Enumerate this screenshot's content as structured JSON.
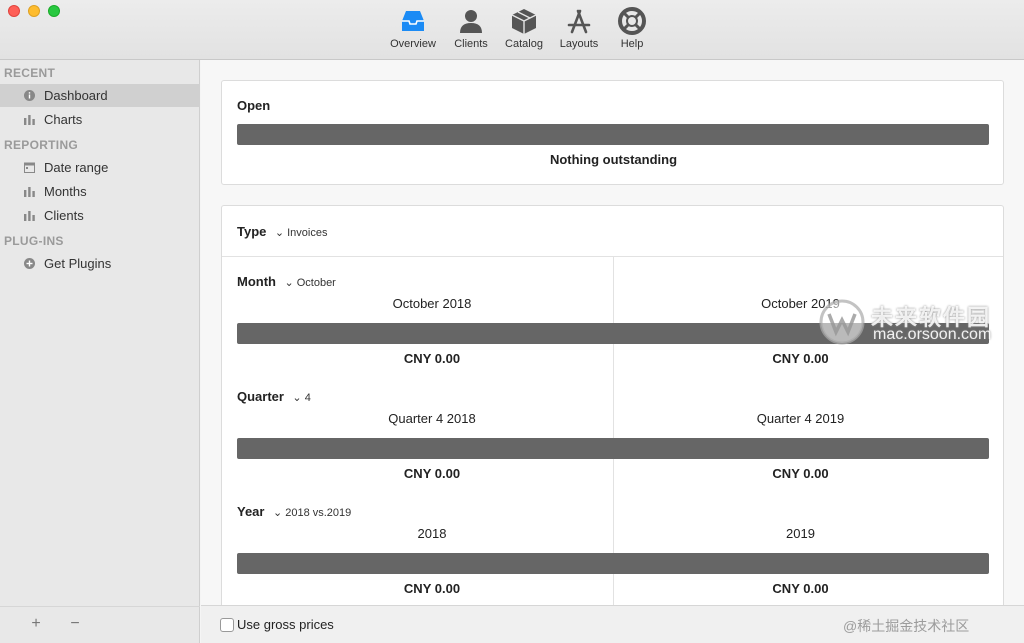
{
  "toolbar": {
    "items": [
      {
        "label": "Overview",
        "icon": "inbox-icon"
      },
      {
        "label": "Clients",
        "icon": "person-icon"
      },
      {
        "label": "Catalog",
        "icon": "box-icon"
      },
      {
        "label": "Layouts",
        "icon": "app-store-icon"
      },
      {
        "label": "Help",
        "icon": "lifebuoy-icon"
      }
    ],
    "accent": "#1b8bf5"
  },
  "sidebar": {
    "sections": [
      {
        "title": "RECENT",
        "items": [
          {
            "label": "Dashboard",
            "icon": "info-icon",
            "selected": true
          },
          {
            "label": "Charts",
            "icon": "bar-chart-icon"
          }
        ]
      },
      {
        "title": "REPORTING",
        "items": [
          {
            "label": "Date range",
            "icon": "calendar-icon"
          },
          {
            "label": "Months",
            "icon": "bar-chart-icon"
          },
          {
            "label": "Clients",
            "icon": "bar-chart-icon"
          }
        ]
      },
      {
        "title": "PLUG-INS",
        "items": [
          {
            "label": "Get Plugins",
            "icon": "plus-circle-icon"
          }
        ]
      }
    ],
    "footer": {
      "add": "+",
      "remove": "−"
    }
  },
  "open_card": {
    "title": "Open",
    "status": "Nothing outstanding"
  },
  "type_card": {
    "type_label": "Type",
    "type_value": "Invoices",
    "groups": [
      {
        "label": "Month",
        "selector": "October",
        "left": {
          "title": "October 2018",
          "amount": "CNY 0.00"
        },
        "right": {
          "title": "October 2019",
          "amount": "CNY 0.00"
        }
      },
      {
        "label": "Quarter",
        "selector": "4",
        "left": {
          "title": "Quarter 4 2018",
          "amount": "CNY 0.00"
        },
        "right": {
          "title": "Quarter 4 2019",
          "amount": "CNY 0.00"
        }
      },
      {
        "label": "Year",
        "selector": "2018 vs.2019",
        "left": {
          "title": "2018",
          "amount": "CNY 0.00"
        },
        "right": {
          "title": "2019",
          "amount": "CNY 0.00"
        }
      }
    ]
  },
  "bottom": {
    "gross_label": "Use gross prices",
    "gross_checked": false
  },
  "watermark": {
    "logo": "未来软件园",
    "url": "mac.orsoon.com",
    "corner": "@稀土掘金技术社区"
  }
}
